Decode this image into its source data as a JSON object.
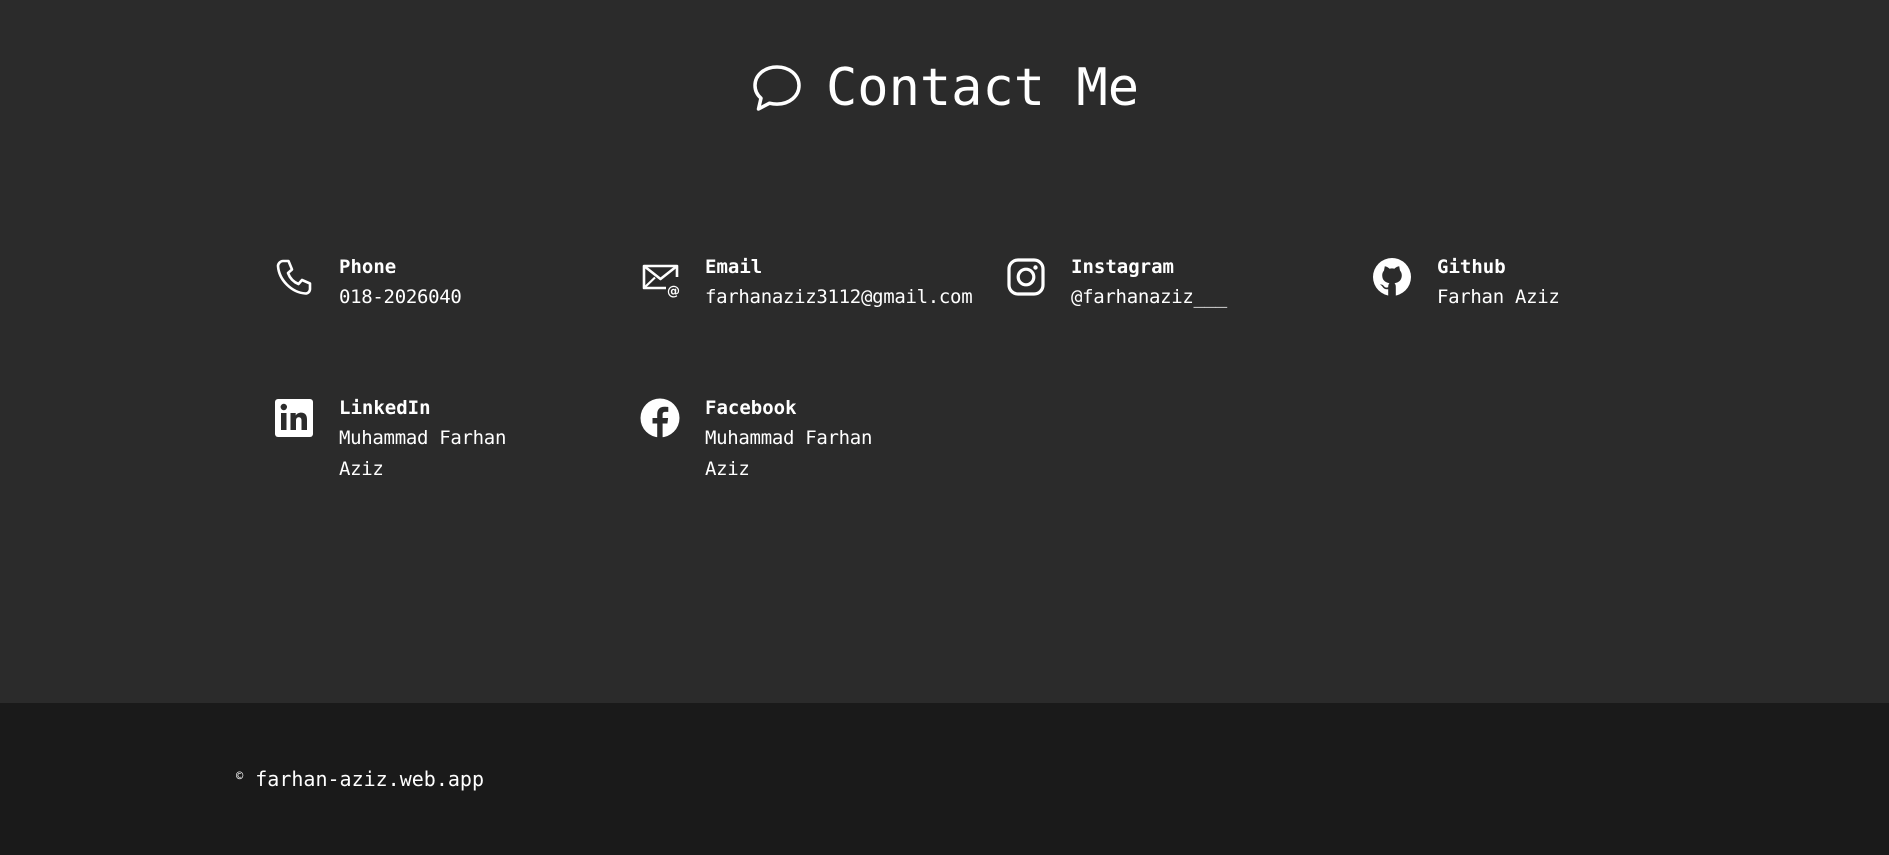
{
  "heading": {
    "title": "Contact Me",
    "icon": "speech-bubble-icon"
  },
  "contacts": [
    {
      "label": "Phone",
      "value": "018-2026040",
      "icon": "phone-icon"
    },
    {
      "label": "Email",
      "value": "farhanaziz3112@gmail.com",
      "icon": "email-icon"
    },
    {
      "label": "Instagram",
      "value": "@farhanaziz___",
      "icon": "instagram-icon"
    },
    {
      "label": "Github",
      "value": "Farhan Aziz",
      "icon": "github-icon"
    },
    {
      "label": "LinkedIn",
      "value": "Muhammad Farhan Aziz",
      "icon": "linkedin-icon"
    },
    {
      "label": "Facebook",
      "value": "Muhammad Farhan Aziz",
      "icon": "facebook-icon"
    }
  ],
  "footer": {
    "copyright_symbol": "©",
    "site": "farhan-aziz.web.app"
  },
  "colors": {
    "section_background": "#2b2b2b",
    "footer_background": "#1a1a1a",
    "text": "#ffffff"
  }
}
